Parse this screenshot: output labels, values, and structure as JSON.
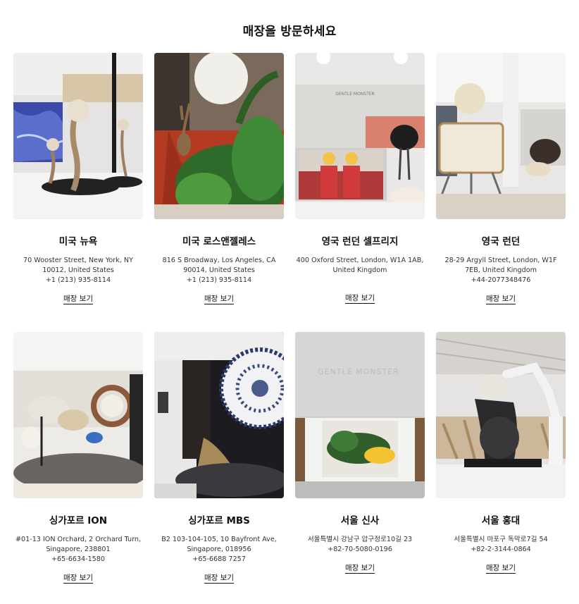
{
  "page_title": "매장을 방문하세요",
  "stores": [
    {
      "name": "미국 뉴욕",
      "address": [
        "70 Wooster Street, New York, NY",
        "10012, United States",
        "+1 (213) 935-8114"
      ],
      "link": "매장 보기"
    },
    {
      "name": "미국 로스앤젤레스",
      "address": [
        "816 S Broadway, Los Angeles, CA",
        "90014, United States",
        "+1 (213) 935-8114"
      ],
      "link": "매장 보기"
    },
    {
      "name": "영국 런던 셀프리지",
      "address": [
        "400 Oxford Street, London, W1A 1AB,",
        "United Kingdom"
      ],
      "link": "매장 보기"
    },
    {
      "name": "영국 런던",
      "address": [
        "28-29 Argyll Street, London, W1F",
        "7EB, United Kingdom",
        "+44-2077348476"
      ],
      "link": "매장 보기"
    },
    {
      "name": "싱가포르 ION",
      "address": [
        "#01-13 ION Orchard, 2 Orchard Turn,",
        "Singapore, 238801",
        "+65-6634-1580"
      ],
      "link": "매장 보기"
    },
    {
      "name": "싱가포르 MBS",
      "address": [
        "B2 103-104-105, 10 Bayfront Ave,",
        "Singapore, 018956",
        "+65-6688 7257"
      ],
      "link": "매장 보기"
    },
    {
      "name": "서울 신사",
      "address": [
        "서울특별시 강남구 압구정로10길 23",
        "+82-70-5080-0196"
      ],
      "link": "매장 보기"
    },
    {
      "name": "서울 홍대",
      "address": [
        "서울특별시 마포구 독막로7길 54",
        "+82-2-3144-0864"
      ],
      "link": "매장 보기"
    }
  ],
  "photo_signage": {
    "london_selfridges": "GENTLE MONSTER",
    "seoul_sinsa": "GENTLE MONSTER"
  }
}
